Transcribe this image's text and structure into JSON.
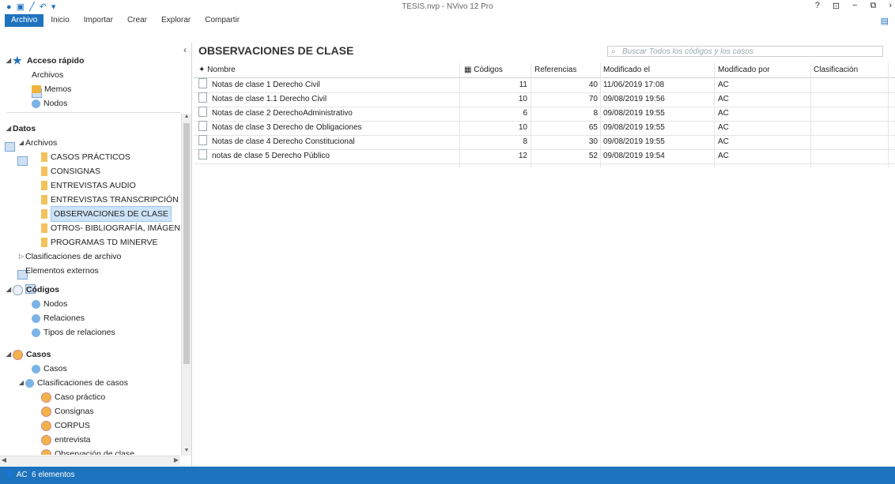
{
  "app": {
    "title": "TESIS.nvp - NVivo 12 Pro"
  },
  "window_controls": [
    "?",
    "⊡",
    "−",
    "⧉",
    "›"
  ],
  "tabs": [
    "Archivo",
    "Inicio",
    "Importar",
    "Crear",
    "Explorar",
    "Compartir"
  ],
  "nav": {
    "quick_access": "Acceso rápido",
    "quick_items": [
      "Archivos",
      "Memos",
      "Nodos"
    ],
    "datos": "Datos",
    "archivos": "Archivos",
    "folders": [
      "CASOS PRÁCTICOS",
      "CONSIGNAS",
      "ENTREVISTAS AUDIO",
      "ENTREVISTAS TRANSCRIPCIÓN",
      "OBSERVACIONES DE CLASE",
      "OTROS- BIBLIOGRAFÍA, IMÁGEN",
      "PROGRAMAS TD MINERVE"
    ],
    "clasif_archivo": "Clasificaciones de archivo",
    "elementos_externos": "Elementos externos",
    "codigos": "Códigos",
    "codigos_items": [
      "Nodos",
      "Relaciones",
      "Tipos de relaciones"
    ],
    "casos": "Casos",
    "casos_item": "Casos",
    "clasif_casos": "Clasificaciones de casos",
    "clasif_casos_items": [
      "Caso práctico",
      "Consignas",
      "CORPUS",
      "entrevista",
      "Observación de clase"
    ]
  },
  "main": {
    "title": "OBSERVACIONES DE CLASE",
    "search_placeholder": "Buscar Todos los códigos y los casos",
    "columns": [
      "Nombre",
      "Códigos",
      "Referencias",
      "Modificado el",
      "Modificado por",
      "Clasificación"
    ],
    "rows": [
      {
        "name": "Notas de clase 1 Derecho Civil",
        "codes": "11",
        "refs": "40",
        "modified": "11/06/2019 17:08",
        "by": "AC"
      },
      {
        "name": "Notas de clase 1.1 Derecho Civil",
        "codes": "10",
        "refs": "70",
        "modified": "09/08/2019 19:56",
        "by": "AC"
      },
      {
        "name": "Notas de clase 2  DerechoAdministrativo",
        "codes": "6",
        "refs": "8",
        "modified": "09/08/2019 19:55",
        "by": "AC"
      },
      {
        "name": "Notas de clase 3 Derecho de Obligaciones",
        "codes": "10",
        "refs": "65",
        "modified": "09/08/2019 19:55",
        "by": "AC"
      },
      {
        "name": "Notas de clase 4 Derecho Constitucional",
        "codes": "8",
        "refs": "30",
        "modified": "09/08/2019 19:55",
        "by": "AC"
      },
      {
        "name": "notas de clase 5  Derecho Público",
        "codes": "12",
        "refs": "52",
        "modified": "09/08/2019 19:54",
        "by": "AC"
      }
    ]
  },
  "status": {
    "user": "AC",
    "count": "6 elementos"
  }
}
